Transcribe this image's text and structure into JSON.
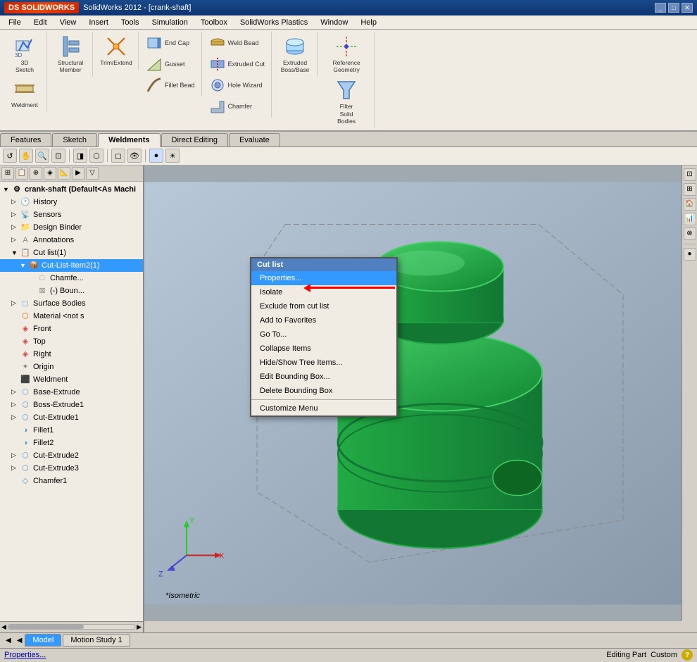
{
  "app": {
    "title": "SolidWorks 2012 - [crank-shaft]",
    "logo": "DS SOLIDWORKS"
  },
  "menubar": {
    "items": [
      "File",
      "Edit",
      "View",
      "Insert",
      "Tools",
      "Simulation",
      "Toolbox",
      "SolidWorks Plastics",
      "Window",
      "Help"
    ]
  },
  "toolbar": {
    "groups": [
      {
        "id": "sketch",
        "buttons": [
          {
            "id": "3d-sketch",
            "label": "3D\nSketch",
            "icon": "✏"
          },
          {
            "id": "weldment",
            "label": "Weldment",
            "icon": "⬛"
          }
        ]
      },
      {
        "id": "structural",
        "buttons": [
          {
            "id": "structural-member",
            "label": "Structural\nMember",
            "icon": "⊞"
          }
        ]
      },
      {
        "id": "trim-extend",
        "buttons": [
          {
            "id": "trim-extend",
            "label": "Trim/Extend",
            "icon": "✂"
          }
        ]
      },
      {
        "id": "extruded",
        "buttons": [
          {
            "id": "extruded-boss",
            "label": "Extruded\nBoss/Base",
            "icon": "⬡"
          }
        ]
      }
    ],
    "small_groups": [
      {
        "id": "end-cap",
        "items": [
          {
            "id": "end-cap",
            "label": "End Cap",
            "icon": "◧"
          },
          {
            "id": "gusset",
            "label": "Gusset",
            "icon": "◨"
          },
          {
            "id": "fillet-bead",
            "label": "Fillet Bead",
            "icon": "◪"
          }
        ]
      },
      {
        "id": "weld-bead",
        "items": [
          {
            "id": "weld-bead",
            "label": "Weld Bead",
            "icon": "≈"
          },
          {
            "id": "extruded-cut",
            "label": "Extruded Cut",
            "icon": "⬢"
          },
          {
            "id": "hole-wizard",
            "label": "Hole Wizard",
            "icon": "⊙"
          },
          {
            "id": "chamfer",
            "label": "Chamfer",
            "icon": "◇"
          }
        ]
      },
      {
        "id": "ref-geometry",
        "items": [
          {
            "id": "reference-geometry",
            "label": "Reference\nGeometry",
            "icon": "⊕"
          },
          {
            "id": "filter-solid",
            "label": "Filter\nSolid\nBodies",
            "icon": "▽"
          }
        ]
      }
    ]
  },
  "tabs": {
    "items": [
      "Features",
      "Sketch",
      "Weldments",
      "Direct Editing",
      "Evaluate"
    ],
    "active": "Weldments"
  },
  "tree": {
    "root_label": "crank-shaft (Default<As Machi",
    "items": [
      {
        "id": "history",
        "label": "History",
        "indent": 1,
        "icon": "🕐",
        "expand": "▷"
      },
      {
        "id": "sensors",
        "label": "Sensors",
        "indent": 1,
        "icon": "📡",
        "expand": "▷"
      },
      {
        "id": "design-binder",
        "label": "Design Binder",
        "indent": 1,
        "icon": "📁",
        "expand": "▷"
      },
      {
        "id": "annotations",
        "label": "Annotations",
        "indent": 1,
        "icon": "A",
        "expand": "▷"
      },
      {
        "id": "cut-list",
        "label": "Cut list(1)",
        "indent": 1,
        "icon": "📋",
        "expand": "▼",
        "selected": false
      },
      {
        "id": "cut-list-item",
        "label": "Cut-List-Item2(1)",
        "indent": 2,
        "icon": "📦",
        "expand": "▼",
        "selected": true
      },
      {
        "id": "chamfer-item",
        "label": "Chamfe...",
        "indent": 3,
        "icon": "□"
      },
      {
        "id": "bounding-box",
        "label": "(-) Boun...",
        "indent": 3,
        "icon": "⊠"
      },
      {
        "id": "surface-bodies",
        "label": "Surface Bodies",
        "indent": 1,
        "icon": "◻",
        "expand": "▷"
      },
      {
        "id": "material",
        "label": "Material <not s",
        "indent": 1,
        "icon": "⬡"
      },
      {
        "id": "front",
        "label": "Front",
        "indent": 1,
        "icon": "◈"
      },
      {
        "id": "top",
        "label": "Top",
        "indent": 1,
        "icon": "◈"
      },
      {
        "id": "right",
        "label": "Right",
        "indent": 1,
        "icon": "◈"
      },
      {
        "id": "origin",
        "label": "Origin",
        "indent": 1,
        "icon": "✦"
      },
      {
        "id": "weldment",
        "label": "Weldment",
        "indent": 1,
        "icon": "⬛"
      },
      {
        "id": "base-extrude",
        "label": "Base-Extrude",
        "indent": 1,
        "icon": "⬡",
        "expand": "▷"
      },
      {
        "id": "boss-extrude1",
        "label": "Boss-Extrude1",
        "indent": 1,
        "icon": "⬡",
        "expand": "▷"
      },
      {
        "id": "cut-extrude1",
        "label": "Cut-Extrude1",
        "indent": 1,
        "icon": "⬡",
        "expand": "▷"
      },
      {
        "id": "fillet1",
        "label": "Fillet1",
        "indent": 1,
        "icon": "◑"
      },
      {
        "id": "fillet2",
        "label": "Fillet2",
        "indent": 1,
        "icon": "◑"
      },
      {
        "id": "cut-extrude2",
        "label": "Cut-Extrude2",
        "indent": 1,
        "icon": "⬡",
        "expand": "▷"
      },
      {
        "id": "cut-extrude3",
        "label": "Cut-Extrude3",
        "indent": 1,
        "icon": "⬡",
        "expand": "▷"
      },
      {
        "id": "chamfer1",
        "label": "Chamfer1",
        "indent": 1,
        "icon": "◇"
      }
    ]
  },
  "context_menu": {
    "header": "Cut list",
    "items": [
      {
        "id": "properties",
        "label": "Properties...",
        "highlighted": true
      },
      {
        "id": "isolate",
        "label": "Isolate"
      },
      {
        "id": "exclude",
        "label": "Exclude from cut list"
      },
      {
        "id": "add-favorites",
        "label": "Add to Favorites"
      },
      {
        "id": "go-to",
        "label": "Go To..."
      },
      {
        "id": "collapse",
        "label": "Collapse Items"
      },
      {
        "id": "hide-show",
        "label": "Hide/Show Tree Items..."
      },
      {
        "id": "edit-bounding",
        "label": "Edit Bounding Box..."
      },
      {
        "id": "delete-bounding",
        "label": "Delete Bounding Box"
      },
      {
        "id": "customize",
        "label": "Customize Menu"
      }
    ]
  },
  "viewport": {
    "label": "*Isometric",
    "model_color": "#22aa44"
  },
  "bottom_tabs": {
    "items": [
      "Model",
      "Motion Study 1"
    ],
    "active": "Model"
  },
  "statusbar": {
    "left": "Properties...",
    "editing": "Editing Part",
    "custom": "Custom"
  }
}
